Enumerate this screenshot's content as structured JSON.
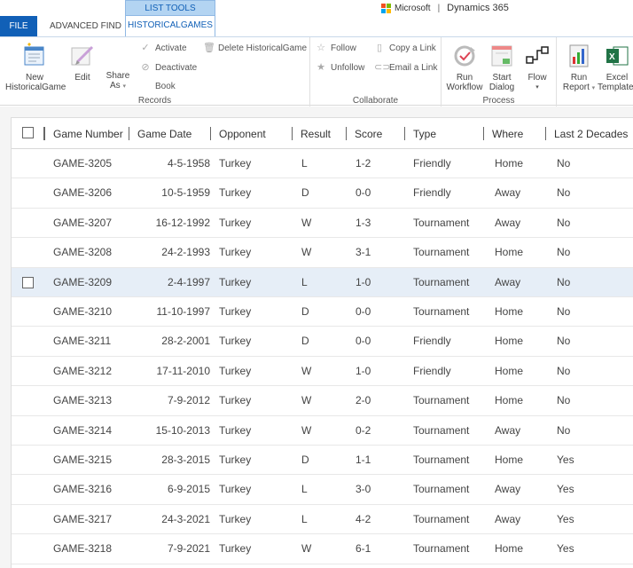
{
  "tabs": {
    "file": "FILE",
    "advanced_find": "ADVANCED FIND",
    "list_tools": "LIST TOOLS",
    "historicalgames": "HISTORICALGAMES"
  },
  "brand": {
    "microsoft": "Microsoft",
    "product": "Dynamics 365",
    "logo_colors": [
      "#f25022",
      "#7fba00",
      "#00a4ef",
      "#ffb900"
    ]
  },
  "ribbon": {
    "records": {
      "label": "Records",
      "new_line1": "New",
      "new_line2": "HistoricalGame",
      "edit": "Edit",
      "share_line1": "Share",
      "share_line2": "As",
      "activate": "Activate",
      "deactivate": "Deactivate",
      "book": "Book",
      "delete": "Delete HistoricalGame"
    },
    "collaborate": {
      "label": "Collaborate",
      "follow": "Follow",
      "unfollow": "Unfollow",
      "copy_link": "Copy a Link",
      "email_link": "Email a Link"
    },
    "process": {
      "label": "Process",
      "run_line1": "Run",
      "run_line2": "Workflow",
      "start_line1": "Start",
      "start_line2": "Dialog",
      "flow": "Flow"
    },
    "data": {
      "report_line1": "Run",
      "report_line2": "Report",
      "excel_line1": "Excel",
      "excel_line2": "Templates"
    }
  },
  "grid": {
    "columns": [
      "Game Number",
      "Game Date",
      "Opponent",
      "Result",
      "Score",
      "Type",
      "Where",
      "Last 2 Decades"
    ],
    "rows": [
      {
        "game": "GAME-3205",
        "date": "4-5-1958",
        "opponent": "Turkey",
        "result": "L",
        "score": "1-2",
        "type": "Friendly",
        "where": "Home",
        "recent": "No"
      },
      {
        "game": "GAME-3206",
        "date": "10-5-1959",
        "opponent": "Turkey",
        "result": "D",
        "score": "0-0",
        "type": "Friendly",
        "where": "Away",
        "recent": "No"
      },
      {
        "game": "GAME-3207",
        "date": "16-12-1992",
        "opponent": "Turkey",
        "result": "W",
        "score": "1-3",
        "type": "Tournament",
        "where": "Away",
        "recent": "No"
      },
      {
        "game": "GAME-3208",
        "date": "24-2-1993",
        "opponent": "Turkey",
        "result": "W",
        "score": "3-1",
        "type": "Tournament",
        "where": "Home",
        "recent": "No"
      },
      {
        "game": "GAME-3209",
        "date": "2-4-1997",
        "opponent": "Turkey",
        "result": "L",
        "score": "1-0",
        "type": "Tournament",
        "where": "Away",
        "recent": "No"
      },
      {
        "game": "GAME-3210",
        "date": "11-10-1997",
        "opponent": "Turkey",
        "result": "D",
        "score": "0-0",
        "type": "Tournament",
        "where": "Home",
        "recent": "No"
      },
      {
        "game": "GAME-3211",
        "date": "28-2-2001",
        "opponent": "Turkey",
        "result": "D",
        "score": "0-0",
        "type": "Friendly",
        "where": "Home",
        "recent": "No"
      },
      {
        "game": "GAME-3212",
        "date": "17-11-2010",
        "opponent": "Turkey",
        "result": "W",
        "score": "1-0",
        "type": "Friendly",
        "where": "Home",
        "recent": "No"
      },
      {
        "game": "GAME-3213",
        "date": "7-9-2012",
        "opponent": "Turkey",
        "result": "W",
        "score": "2-0",
        "type": "Tournament",
        "where": "Home",
        "recent": "No"
      },
      {
        "game": "GAME-3214",
        "date": "15-10-2013",
        "opponent": "Turkey",
        "result": "W",
        "score": "0-2",
        "type": "Tournament",
        "where": "Away",
        "recent": "No"
      },
      {
        "game": "GAME-3215",
        "date": "28-3-2015",
        "opponent": "Turkey",
        "result": "D",
        "score": "1-1",
        "type": "Tournament",
        "where": "Home",
        "recent": "Yes"
      },
      {
        "game": "GAME-3216",
        "date": "6-9-2015",
        "opponent": "Turkey",
        "result": "L",
        "score": "3-0",
        "type": "Tournament",
        "where": "Away",
        "recent": "Yes"
      },
      {
        "game": "GAME-3217",
        "date": "24-3-2021",
        "opponent": "Turkey",
        "result": "L",
        "score": "4-2",
        "type": "Tournament",
        "where": "Away",
        "recent": "Yes"
      },
      {
        "game": "GAME-3218",
        "date": "7-9-2021",
        "opponent": "Turkey",
        "result": "W",
        "score": "6-1",
        "type": "Tournament",
        "where": "Home",
        "recent": "Yes"
      }
    ]
  }
}
